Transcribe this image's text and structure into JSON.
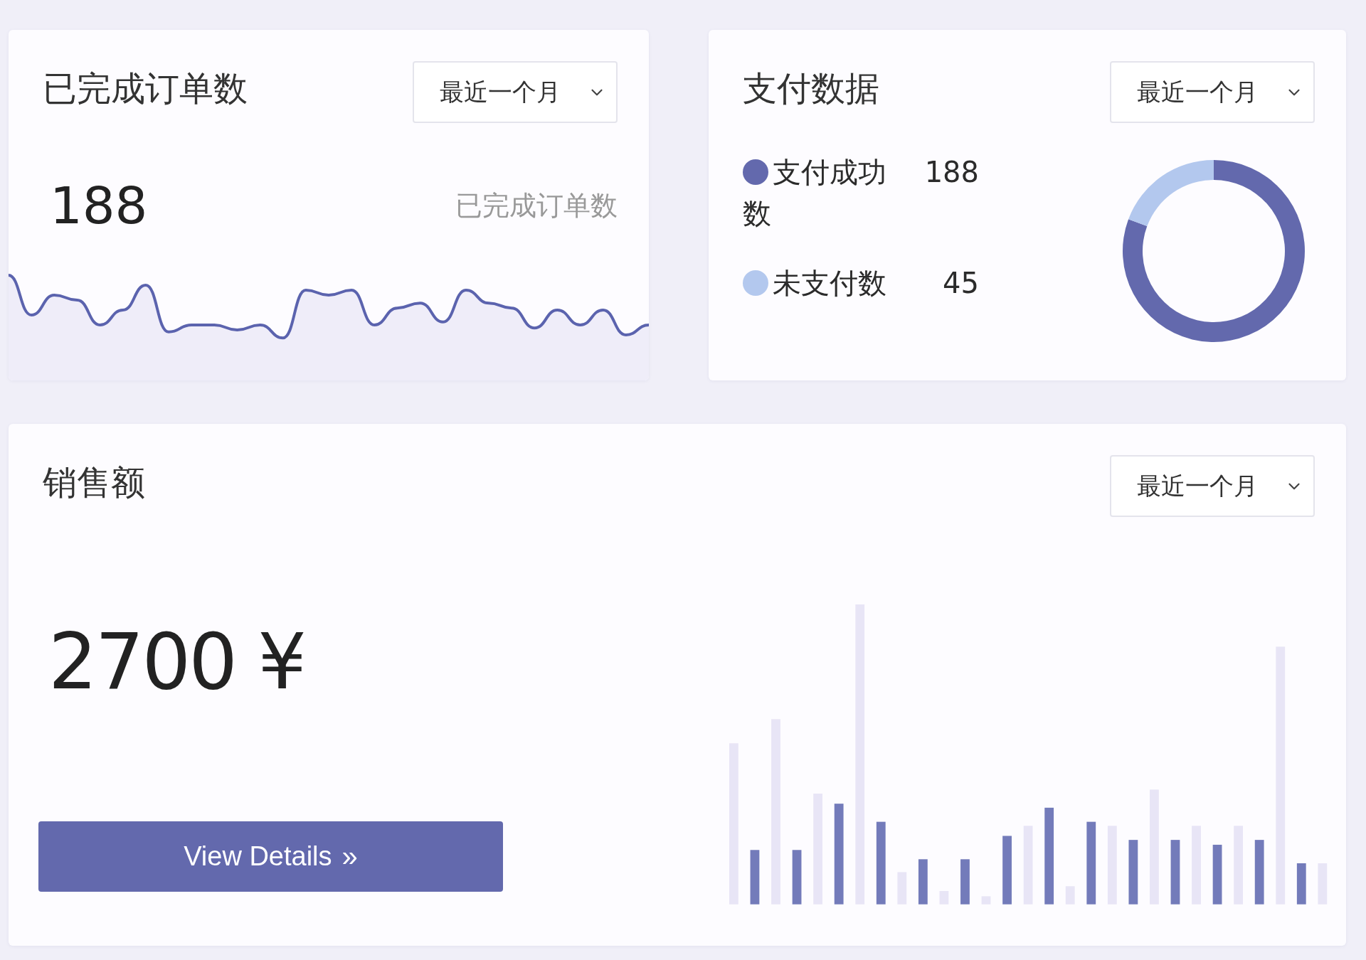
{
  "orders_card": {
    "title": "已完成订单数",
    "period_select": {
      "value": "最近一个月"
    },
    "count": "188",
    "caption": "已完成订单数"
  },
  "payment_card": {
    "title": "支付数据",
    "period_select": {
      "value": "最近一个月"
    },
    "legend": [
      {
        "label": "支付成功数",
        "value": "188",
        "color": "#6369ad"
      },
      {
        "label": "未支付数",
        "value": "45",
        "color": "#b3c8ee"
      }
    ]
  },
  "sales_card": {
    "title": "销售额",
    "period_select": {
      "value": "最近一个月"
    },
    "amount": "2700 ¥",
    "button": {
      "label": "View Details",
      "icon": "»"
    }
  }
}
